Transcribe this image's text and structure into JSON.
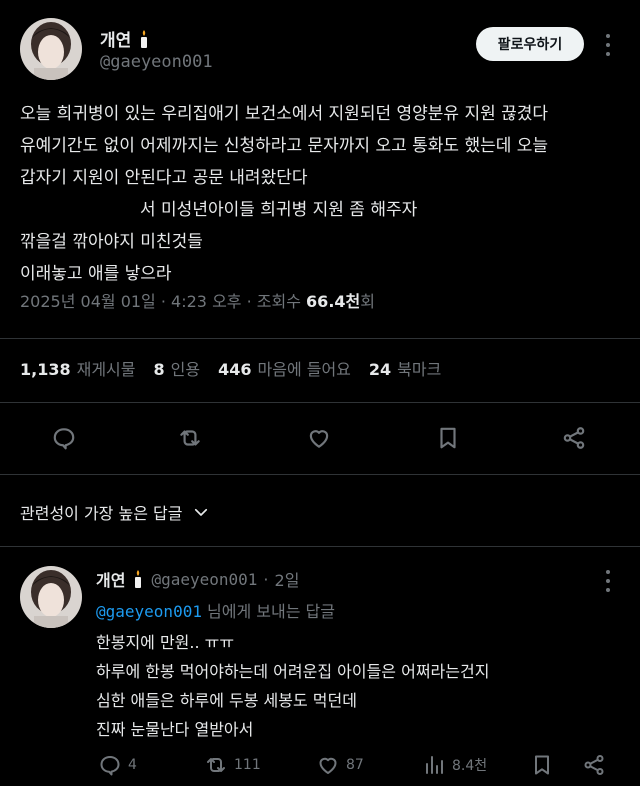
{
  "post": {
    "display_name": "개연",
    "handle": "@gaeyeon001",
    "follow_label": "팔로우하기",
    "body_lines": [
      "오늘 희귀병이 있는 우리집애기 보건소에서 지원되던 영양분유 지원 끊겼다",
      "유예기간도 없이 어제까지는 신청하라고 문자까지 오고 통화도 했는데 오늘",
      "갑자기 지원이 안된다고 공문 내려왔단다",
      "서 미성년아이들 희귀병 지원 좀 해주자",
      "깎을걸 깎아야지 미친것들",
      "이래놓고 애를 낳으라"
    ],
    "date": "2025년 04월 01일",
    "time": "4:23 오후",
    "views_label": "조회수",
    "views_value": "66.4천",
    "views_suffix": "회",
    "stats": {
      "reposts_num": "1,138",
      "reposts_label": "재게시물",
      "quotes_num": "8",
      "quotes_label": "인용",
      "likes_num": "446",
      "likes_label": "마음에 들어요",
      "bookmarks_num": "24",
      "bookmarks_label": "북마크"
    }
  },
  "sort": {
    "label": "관련성이 가장 높은 답글"
  },
  "reply": {
    "display_name": "개연",
    "handle": "@gaeyeon001",
    "time": "2일",
    "reply_to_mention": "@gaeyeon001",
    "reply_to_suffix": " 님에게 보내는 답글",
    "body_lines": [
      "한봉지에 만원.. ㅠㅠ",
      "하루에 한봉 먹어야하는데 어려운집 아이들은 어쩌라는건지",
      "심한 애들은 하루에 두봉 세봉도 먹던데",
      "진짜 눈물난다 열받아서"
    ],
    "replies": "4",
    "reposts": "111",
    "likes": "87",
    "views": "8.4천"
  },
  "icons": {
    "reply": "reply-icon",
    "repost": "repost-icon",
    "like": "heart-icon",
    "bookmark": "bookmark-icon",
    "share": "share-icon",
    "views": "analytics-icon",
    "more": "more-icon",
    "chevron": "chevron-down-icon",
    "candle": "candle-emoji-icon"
  },
  "colors": {
    "background": "#000000",
    "text": "#e7e9ea",
    "muted": "#71767b",
    "link": "#1d9bf0",
    "divider": "#2f3336"
  }
}
